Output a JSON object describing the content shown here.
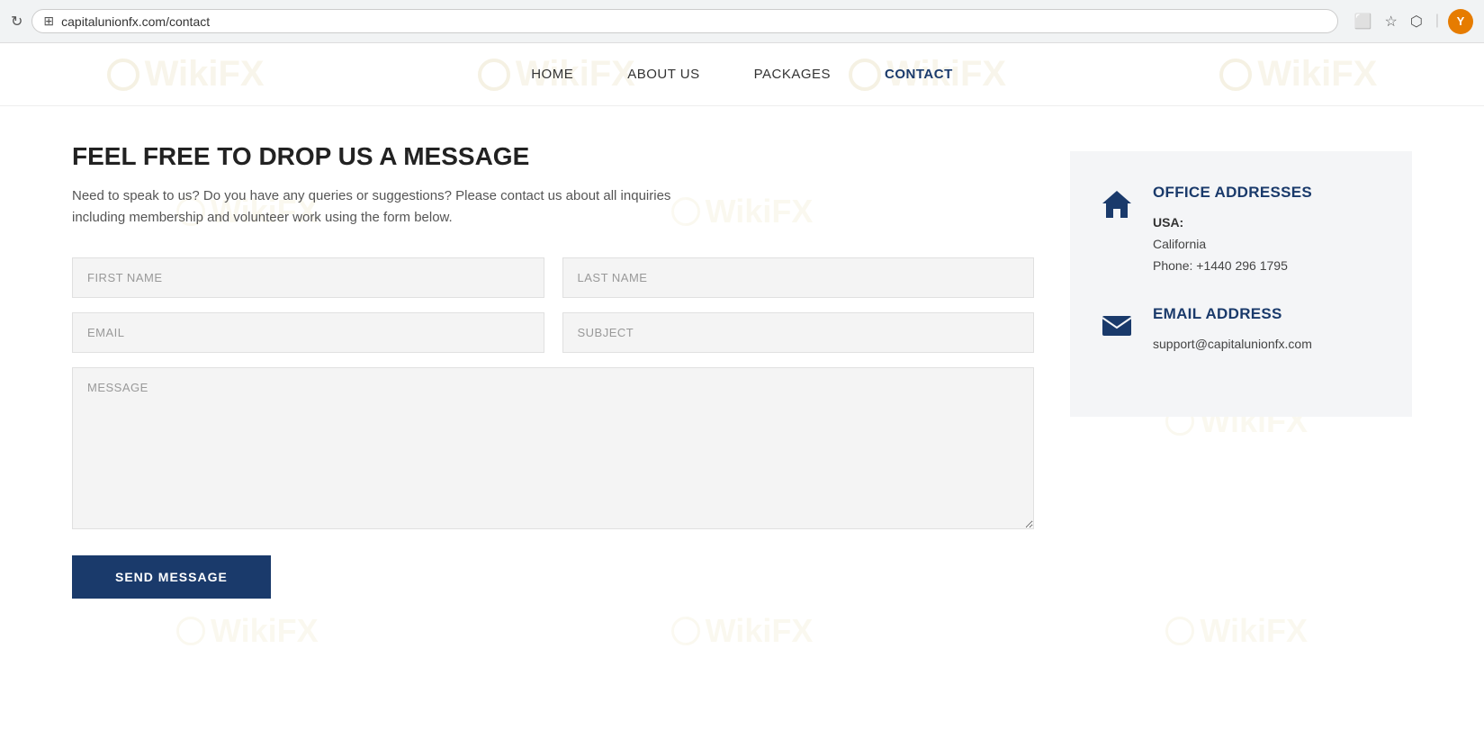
{
  "browser": {
    "url": "capitalunionfx.com/contact",
    "avatar_letter": "Y"
  },
  "navbar": {
    "links": [
      {
        "label": "HOME",
        "active": false
      },
      {
        "label": "ABOUT US",
        "active": false
      },
      {
        "label": "PACKAGES",
        "active": false
      },
      {
        "label": "CONTACT",
        "active": true
      }
    ]
  },
  "form": {
    "title": "FEEL FREE TO DROP US A MESSAGE",
    "description": "Need to speak to us? Do you have any queries or suggestions? Please contact us about all inquiries including membership and volunteer work using the form below.",
    "first_name_placeholder": "FIRST NAME",
    "last_name_placeholder": "LAST NAME",
    "email_placeholder": "EMAIL",
    "subject_placeholder": "SUBJECT",
    "message_placeholder": "MESSAGE",
    "send_button_label": "SEND MESSAGE"
  },
  "sidebar": {
    "office_addresses_title": "OFFICE ADDRESSES",
    "country_label": "USA:",
    "city": "California",
    "phone_label": "Phone:",
    "phone_number": "+1440 296 1795",
    "email_title": "EMAIL ADDRESS",
    "email_address": "support@capitalunionfx.com"
  },
  "watermark": {
    "text": "WikiFX"
  }
}
